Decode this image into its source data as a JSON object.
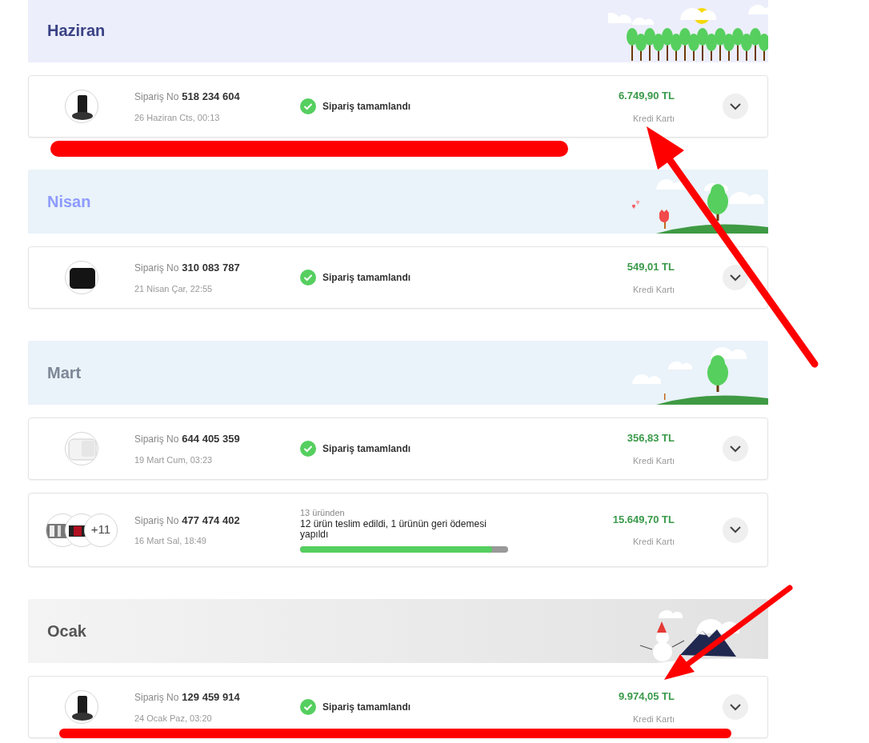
{
  "months": [
    {
      "title": "Haziran",
      "kind": "summer",
      "orders": [
        {
          "kind": "complete",
          "thumbnails": [
            {
              "kind": "dock"
            }
          ],
          "label": "Sipariş No",
          "number": "518 234 604",
          "date": "26 Haziran Cts, 00:13",
          "status": "Sipariş tamamlandı",
          "price": "6.749,90 TL",
          "payment": "Kredi Kartı"
        }
      ]
    },
    {
      "title": "Nisan",
      "kind": "spring",
      "orders": [
        {
          "kind": "complete",
          "thumbnails": [
            {
              "kind": "box"
            }
          ],
          "label": "Sipariş No",
          "number": "310 083 787",
          "date": "21 Nisan Çar, 22:55",
          "status": "Sipariş tamamlandı",
          "price": "549,01 TL",
          "payment": "Kredi Kartı"
        }
      ]
    },
    {
      "title": "Mart",
      "kind": "early-spring",
      "orders": [
        {
          "kind": "complete",
          "thumbnails": [
            {
              "kind": "white"
            }
          ],
          "label": "Sipariş No",
          "number": "644 405 359",
          "date": "19 Mart Cum, 03:23",
          "status": "Sipariş tamamlandı",
          "price": "356,83 TL",
          "payment": "Kredi Kartı"
        },
        {
          "kind": "partial",
          "thumbnails": [
            {
              "kind": "metal"
            },
            {
              "kind": "red"
            }
          ],
          "more": "+11",
          "label": "Sipariş No",
          "number": "477 474 402",
          "date": "16 Mart Sal, 18:49",
          "count_text": "13 üründen",
          "status": "12 ürün teslim edildi, 1 ürünün geri ödemesi yapıldı",
          "level": 0.923,
          "price": "15.649,70 TL",
          "payment": "Kredi Kartı"
        }
      ]
    },
    {
      "title": "Ocak",
      "kind": "winter",
      "orders": [
        {
          "kind": "complete",
          "thumbnails": [
            {
              "kind": "dock"
            }
          ],
          "label": "Sipariş No",
          "number": "129 459 914",
          "date": "24 Ocak Paz, 03:20",
          "status": "Sipariş tamamlandı",
          "price": "9.974,05 TL",
          "payment": "Kredi Kartı"
        }
      ]
    }
  ]
}
